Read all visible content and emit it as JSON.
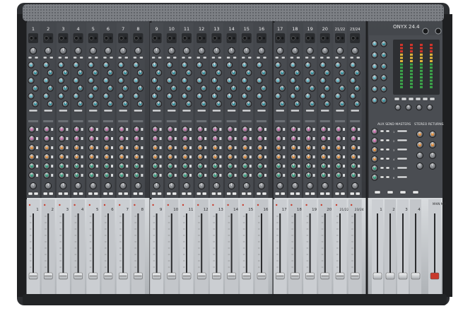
{
  "brand": {
    "model": "ONYX 24.4"
  },
  "channels": {
    "top_numbers": [
      "1",
      "2",
      "3",
      "4",
      "5",
      "6",
      "7",
      "8",
      "9",
      "10",
      "11",
      "12",
      "13",
      "14",
      "15",
      "16",
      "17",
      "18",
      "19",
      "20",
      "21/22",
      "23/24"
    ],
    "fader_numbers": [
      "1",
      "2",
      "3",
      "4",
      "5",
      "6",
      "7",
      "8",
      "9",
      "10",
      "11",
      "12",
      "13",
      "14",
      "15",
      "16",
      "17",
      "18",
      "19",
      "20",
      "21/22",
      "23/24"
    ]
  },
  "master": {
    "aux_send_masters_label": "AUX SEND MASTERS",
    "stereo_returns_label": "STEREO RETURNS",
    "group_fader_numbers": [
      "1",
      "2",
      "3",
      "4"
    ],
    "main_mix_label": "MAIN MIX"
  },
  "colors": {
    "body": "#3a3c40",
    "panel": "#4a4d52",
    "fader_bay": "#c9ccd0",
    "knob_teal": "#2f8f9d",
    "knob_pink": "#c76aa8",
    "knob_orange": "#d9893a",
    "knob_green": "#2f9a7a",
    "knob_gray": "#8a8d92"
  }
}
